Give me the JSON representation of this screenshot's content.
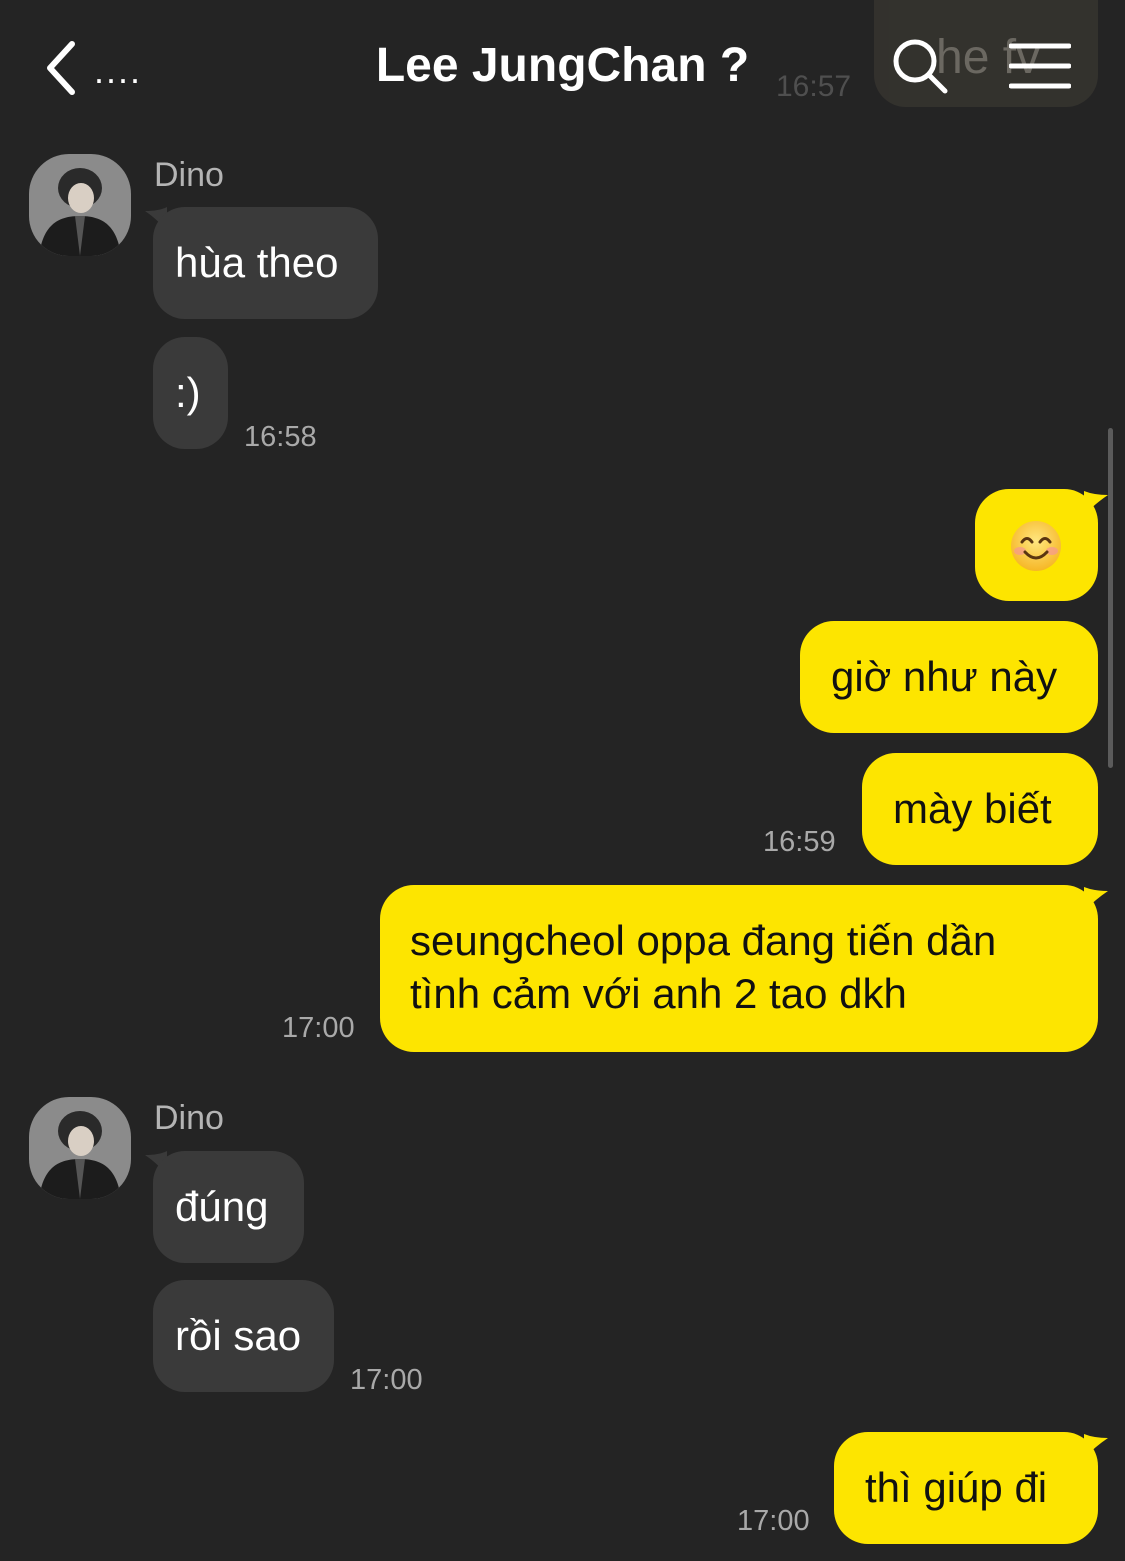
{
  "header": {
    "back_label": "....",
    "title": "Lee JungChan ?",
    "ghost_message": "he fv",
    "ghost_time": "16:57"
  },
  "messages": [
    {
      "side": "in",
      "sender": "Dino",
      "text": "hùa theo"
    },
    {
      "side": "in",
      "text": ":)",
      "time": "16:58"
    },
    {
      "side": "out",
      "emoji": "smiling-face-emoji"
    },
    {
      "side": "out",
      "text": "giờ như này"
    },
    {
      "side": "out",
      "text": "mày biết",
      "time": "16:59"
    },
    {
      "side": "out",
      "lines": [
        "seungcheol oppa đang tiến dần",
        "tình cảm với anh 2 tao dkh"
      ],
      "time": "17:00"
    },
    {
      "side": "in",
      "sender": "Dino",
      "text": "đúng"
    },
    {
      "side": "in",
      "text": "rồi sao",
      "time": "17:00"
    },
    {
      "side": "out",
      "text": "thì giúp đi",
      "time": "17:00"
    }
  ],
  "icons": {
    "back": "chevron-left-icon",
    "search": "search-icon",
    "menu": "hamburger-menu-icon"
  },
  "colors": {
    "background": "#242424",
    "incoming_bubble": "#3a3a3a",
    "outgoing_bubble": "#fde500",
    "timestamp": "#a9a9a9"
  }
}
